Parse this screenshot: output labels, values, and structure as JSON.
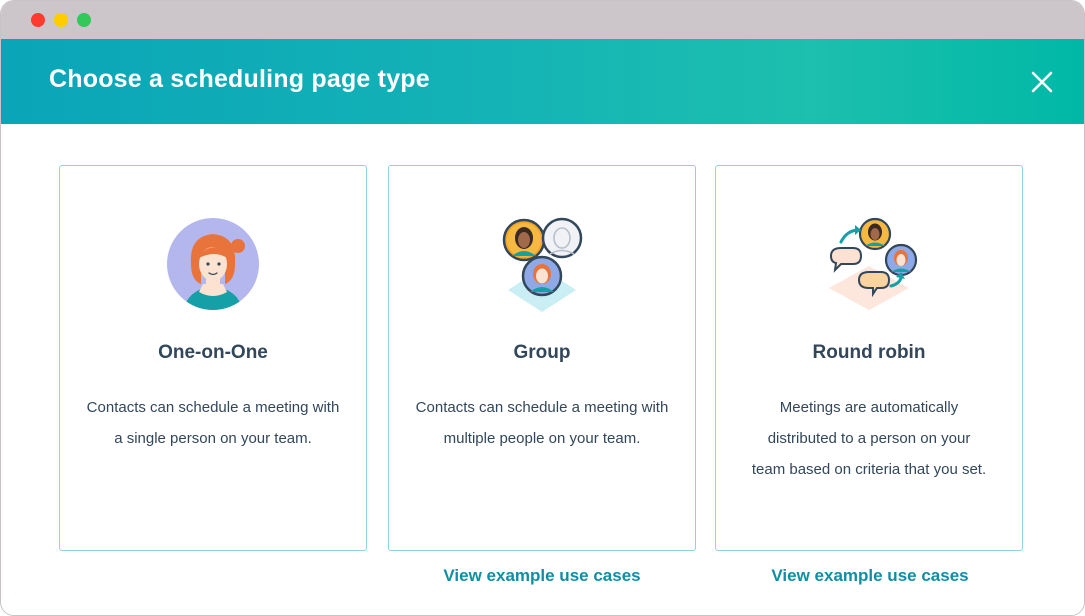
{
  "modal": {
    "title": "Choose a scheduling page type",
    "close_icon": "close-icon"
  },
  "colors": {
    "header_gradient_start": "#0aa5b8",
    "header_gradient_end": "#00b8a6",
    "card_border": "#8fd3de",
    "text_primary": "#33475b",
    "link": "#0e8fa3"
  },
  "cards": [
    {
      "title": "One-on-One",
      "description": "Contacts can schedule a meeting with a single person on your team.",
      "icon": "single-person-avatar-icon"
    },
    {
      "title": "Group",
      "description": "Contacts can schedule a meeting with multiple people on your team.",
      "icon": "group-avatars-icon",
      "link": "View example use cases"
    },
    {
      "title": "Round robin",
      "description": "Meetings are automatically distributed to a person on your team based on criteria that you set.",
      "icon": "round-robin-icon",
      "link": "View example use cases"
    }
  ]
}
